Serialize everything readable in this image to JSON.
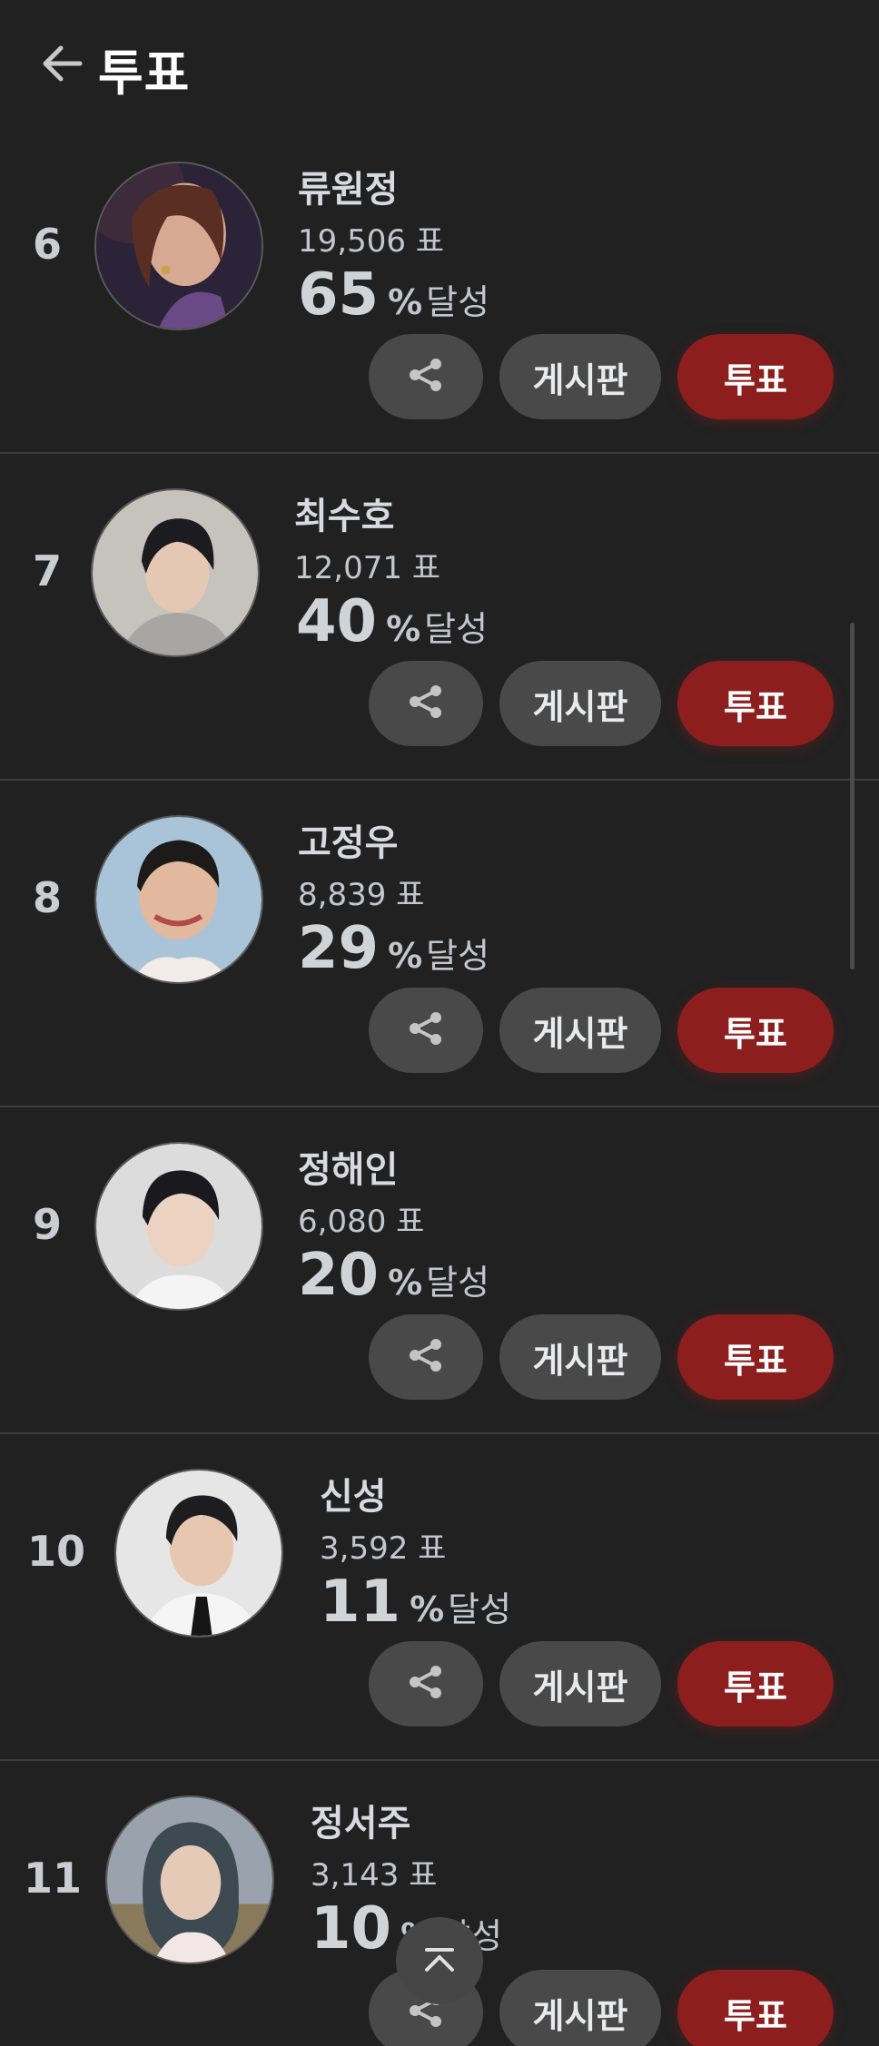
{
  "header": {
    "title": "투표",
    "back_icon": "arrow-left-icon"
  },
  "colors": {
    "background": "#212121",
    "button_gray": "#494949",
    "vote_red": "#8c1e1e",
    "divider": "#3d3d3d"
  },
  "entries": [
    {
      "rank": "6",
      "name": "류원정",
      "votes": "19,506 표",
      "percent": "65",
      "percent_sign": "%",
      "percent_label": "달성"
    },
    {
      "rank": "7",
      "name": "최수호",
      "votes": "12,071 표",
      "percent": "40",
      "percent_sign": "%",
      "percent_label": "달성"
    },
    {
      "rank": "8",
      "name": "고정우",
      "votes": "8,839 표",
      "percent": "29",
      "percent_sign": "%",
      "percent_label": "달성"
    },
    {
      "rank": "9",
      "name": "정해인",
      "votes": "6,080 표",
      "percent": "20",
      "percent_sign": "%",
      "percent_label": "달성"
    },
    {
      "rank": "10",
      "name": "신성",
      "votes": "3,592 표",
      "percent": "11",
      "percent_sign": "%",
      "percent_label": "달성"
    },
    {
      "rank": "11",
      "name": "정서주",
      "votes": "3,143 표",
      "percent": "10",
      "percent_sign": "%",
      "percent_label": "달성"
    }
  ],
  "actions": {
    "share_icon": "share-icon",
    "board_label": "게시판",
    "vote_label": "투표"
  },
  "scroll_top_icon": "chevron-up-icon"
}
